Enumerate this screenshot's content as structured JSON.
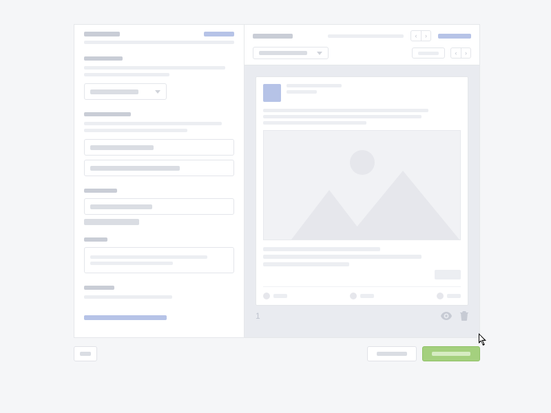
{
  "left": {
    "header_title_w": 52,
    "header_link_w": 44,
    "intro1_w": 218,
    "intro2_w": 150,
    "sections": [
      {
        "title_w": 56,
        "para": [
          205,
          124
        ],
        "kind": "dropdown",
        "dd_label_w": 70,
        "dd_w": 120
      },
      {
        "title_w": 68,
        "para": [
          200,
          150
        ],
        "kind": "double_input",
        "in1_w": 92,
        "in2_w": 130
      },
      {
        "title_w": 48,
        "para": [],
        "kind": "input_stack",
        "in_w": 90,
        "stack_w": 80
      },
      {
        "title_w": 34,
        "para": [],
        "kind": "multiline",
        "line1_w": 170,
        "line2_w": 120
      },
      {
        "title_w": 44,
        "para": [
          128
        ],
        "kind": "none"
      }
    ],
    "footer_link_w": 120
  },
  "right": {
    "header": {
      "title_w": 58,
      "sub_w": 110,
      "link_w": 48,
      "dd_w": 110,
      "dd_label_w": 70,
      "pill_label_w": 30
    },
    "post": {
      "name_w": 80,
      "meta_w": 44,
      "copy": [
        240,
        230,
        150
      ],
      "footer": [
        170,
        230,
        125
      ],
      "actions": 3
    },
    "meta_index": "1"
  },
  "bottom": {
    "back_label_w": 16,
    "secondary_label_w": 44,
    "primary_label_w": 56
  }
}
